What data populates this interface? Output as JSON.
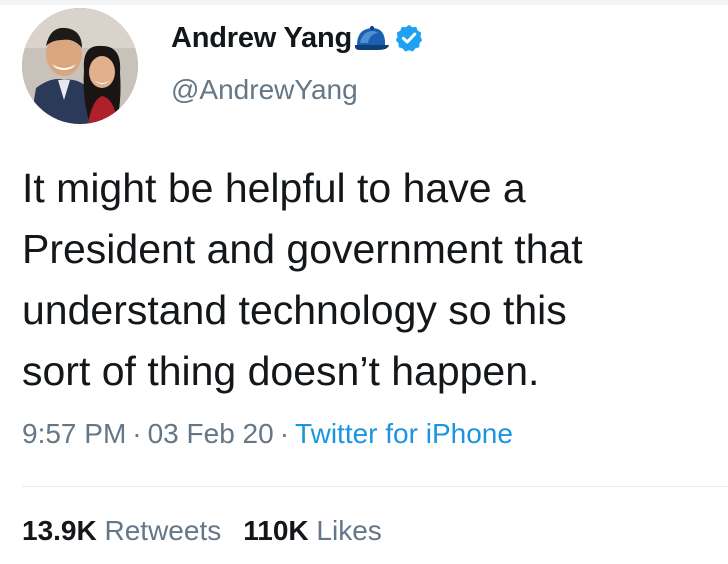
{
  "author": {
    "display_name": "Andrew Yang",
    "handle": "@AndrewYang",
    "verified": true,
    "emoji_icon": "blue-cap-icon",
    "avatar_icon": "profile-photo"
  },
  "tweet": {
    "text_lines": [
      "It might be helpful to have a",
      "President and government that",
      "understand technology so this",
      "sort of thing doesn’t happen."
    ],
    "time": "9:57 PM",
    "date": "03 Feb 20",
    "separator": "·",
    "source": "Twitter for iPhone"
  },
  "stats": {
    "retweets_count": "13.9K",
    "retweets_label": "Retweets",
    "likes_count": "110K",
    "likes_label": "Likes"
  },
  "colors": {
    "text": "#14171a",
    "secondary": "#657786",
    "link": "#1b95e0",
    "verified": "#1da1f2",
    "divider": "#e6ecf0"
  }
}
